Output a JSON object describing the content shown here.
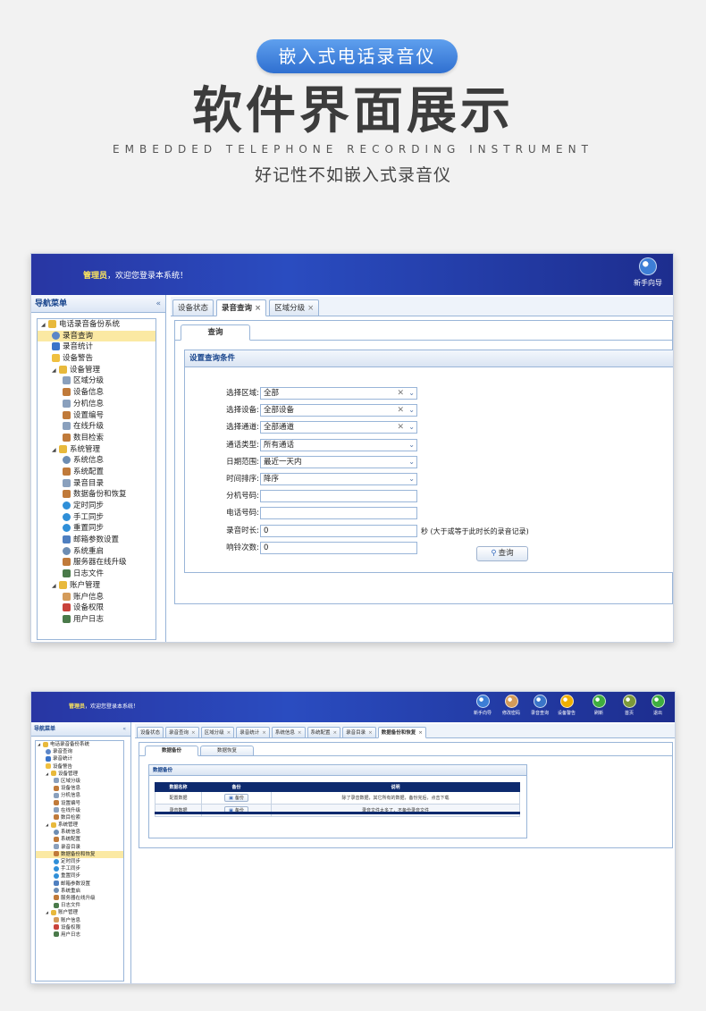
{
  "banner": {
    "pill": "嵌入式电话录音仪",
    "title": "软件界面展示",
    "eng": "EMBEDDED  TELEPHONE  RECORDING  INSTRUMENT",
    "slogan": "好记性不如嵌入式录音仪"
  },
  "colors": {
    "header": "#2836a3",
    "accent": "#2f6fd0",
    "selected": "#fbe9a3",
    "border": "#99b5d8",
    "table_header": "#0d2a6e"
  },
  "shot1": {
    "user": "管理员",
    "welcome": "，欢迎您登录本系统！",
    "toolbar": [
      {
        "label": "新手向导",
        "icon": "guide-icon"
      }
    ],
    "nav_title": "导航菜单",
    "collapse": "«",
    "tree": [
      {
        "label": "电话录音备份系统",
        "icon": "folder-icon",
        "level": 0
      },
      {
        "label": "录音查询",
        "icon": "search-icon",
        "level": 1,
        "selected": true
      },
      {
        "label": "录音统计",
        "icon": "chart-icon",
        "level": 1
      },
      {
        "label": "设备警告",
        "icon": "bulb-icon",
        "level": 1
      },
      {
        "label": "设备管理",
        "icon": "folder-icon",
        "level": 1
      },
      {
        "label": "区域分级",
        "icon": "edit-icon",
        "level": 2
      },
      {
        "label": "设备信息",
        "icon": "tools-icon",
        "level": 2
      },
      {
        "label": "分机信息",
        "icon": "edit-icon",
        "level": 2
      },
      {
        "label": "设置编号",
        "icon": "tools-icon",
        "level": 2
      },
      {
        "label": "在线升级",
        "icon": "edit-icon",
        "level": 2
      },
      {
        "label": "数目检索",
        "icon": "tools-icon",
        "level": 2
      },
      {
        "label": "系统管理",
        "icon": "folder-icon",
        "level": 1
      },
      {
        "label": "系统信息",
        "icon": "gear-icon",
        "level": 2
      },
      {
        "label": "系统配置",
        "icon": "tools-icon",
        "level": 2
      },
      {
        "label": "录音目录",
        "icon": "edit-icon",
        "level": 2
      },
      {
        "label": "数据备份和恢复",
        "icon": "tools-icon",
        "level": 2
      },
      {
        "label": "定时同步",
        "icon": "clock-icon",
        "level": 2
      },
      {
        "label": "手工同步",
        "icon": "clock-icon",
        "level": 2
      },
      {
        "label": "重置同步",
        "icon": "clock-icon",
        "level": 2
      },
      {
        "label": "邮箱参数设置",
        "icon": "mail-icon",
        "level": 2
      },
      {
        "label": "系统重启",
        "icon": "gear-icon",
        "level": 2
      },
      {
        "label": "服务器在线升级",
        "icon": "tools-icon",
        "level": 2
      },
      {
        "label": "日志文件",
        "icon": "log-icon",
        "level": 2
      },
      {
        "label": "账户管理",
        "icon": "folder-icon",
        "level": 1
      },
      {
        "label": "账户信息",
        "icon": "user-icon",
        "level": 2
      },
      {
        "label": "设备权限",
        "icon": "shield-icon",
        "level": 2
      },
      {
        "label": "用户日志",
        "icon": "log-icon",
        "level": 2
      }
    ],
    "tabs": [
      {
        "label": "设备状态",
        "closable": false
      },
      {
        "label": "录音查询",
        "closable": true,
        "active": true
      },
      {
        "label": "区域分级",
        "closable": true
      }
    ],
    "subtab": "查询",
    "panel_title": "设置查询条件",
    "form": [
      {
        "label": "选择区域:",
        "value": "全部",
        "clear": true,
        "dropdown": true
      },
      {
        "label": "选择设备:",
        "value": "全部设备",
        "clear": true,
        "dropdown": true
      },
      {
        "label": "选择通道:",
        "value": "全部通道",
        "clear": true,
        "dropdown": true
      },
      {
        "label": "通话类型:",
        "value": "所有通话",
        "clear": false,
        "dropdown": true
      },
      {
        "label": "日期范围:",
        "value": "最近一天内",
        "clear": false,
        "dropdown": true
      },
      {
        "label": "时间排序:",
        "value": "降序",
        "clear": false,
        "dropdown": true
      },
      {
        "label": "分机号码:",
        "value": "",
        "clear": false,
        "dropdown": false
      },
      {
        "label": "电话号码:",
        "value": "",
        "clear": false,
        "dropdown": false
      },
      {
        "label": "录音时长:",
        "value": "0",
        "clear": false,
        "dropdown": false,
        "hint": "秒 (大于或等于此时长的录音记录)"
      },
      {
        "label": "响铃次数:",
        "value": "0",
        "clear": false,
        "dropdown": false
      }
    ],
    "query_button": "查询"
  },
  "shot2": {
    "user": "管理员",
    "welcome": "，欢迎您登录本系统！",
    "toolbar": [
      {
        "label": "新手向导",
        "icon": "guide-icon"
      },
      {
        "label": "修改密码",
        "icon": "user-icon"
      },
      {
        "label": "录音查询",
        "icon": "chart-icon"
      },
      {
        "label": "设备警告",
        "icon": "warning-icon"
      },
      {
        "label": "刷新",
        "icon": "refresh-icon"
      },
      {
        "label": "首页",
        "icon": "home-icon"
      },
      {
        "label": "退出",
        "icon": "logout-icon"
      }
    ],
    "nav_title": "导航菜单",
    "collapse": "«",
    "tree": [
      {
        "label": "电话录音备份系统",
        "icon": "folder-icon",
        "level": 0
      },
      {
        "label": "录音查询",
        "icon": "search-icon",
        "level": 1
      },
      {
        "label": "录音统计",
        "icon": "chart-icon",
        "level": 1
      },
      {
        "label": "设备警告",
        "icon": "bulb-icon",
        "level": 1
      },
      {
        "label": "设备管理",
        "icon": "folder-icon",
        "level": 1
      },
      {
        "label": "区域分级",
        "icon": "edit-icon",
        "level": 2
      },
      {
        "label": "设备信息",
        "icon": "tools-icon",
        "level": 2
      },
      {
        "label": "分机信息",
        "icon": "edit-icon",
        "level": 2
      },
      {
        "label": "设置编号",
        "icon": "tools-icon",
        "level": 2
      },
      {
        "label": "在线升级",
        "icon": "edit-icon",
        "level": 2
      },
      {
        "label": "数目检索",
        "icon": "tools-icon",
        "level": 2
      },
      {
        "label": "系统管理",
        "icon": "folder-icon",
        "level": 1
      },
      {
        "label": "系统信息",
        "icon": "gear-icon",
        "level": 2
      },
      {
        "label": "系统配置",
        "icon": "tools-icon",
        "level": 2
      },
      {
        "label": "录音目录",
        "icon": "edit-icon",
        "level": 2
      },
      {
        "label": "数据备份和恢复",
        "icon": "tools-icon",
        "level": 2,
        "selected": true
      },
      {
        "label": "定时同步",
        "icon": "clock-icon",
        "level": 2
      },
      {
        "label": "手工同步",
        "icon": "clock-icon",
        "level": 2
      },
      {
        "label": "重置同步",
        "icon": "clock-icon",
        "level": 2
      },
      {
        "label": "邮箱参数设置",
        "icon": "mail-icon",
        "level": 2
      },
      {
        "label": "系统重启",
        "icon": "gear-icon",
        "level": 2
      },
      {
        "label": "服务器在线升级",
        "icon": "tools-icon",
        "level": 2
      },
      {
        "label": "日志文件",
        "icon": "log-icon",
        "level": 2
      },
      {
        "label": "账户管理",
        "icon": "folder-icon",
        "level": 1
      },
      {
        "label": "账户信息",
        "icon": "user-icon",
        "level": 2
      },
      {
        "label": "设备权限",
        "icon": "shield-icon",
        "level": 2
      },
      {
        "label": "用户日志",
        "icon": "log-icon",
        "level": 2
      }
    ],
    "tabs": [
      {
        "label": "设备状态",
        "closable": false
      },
      {
        "label": "录音查询",
        "closable": true
      },
      {
        "label": "区域分级",
        "closable": true
      },
      {
        "label": "录音统计",
        "closable": true
      },
      {
        "label": "系统信息",
        "closable": true
      },
      {
        "label": "系统配置",
        "closable": true
      },
      {
        "label": "录音目录",
        "closable": true
      },
      {
        "label": "数据备份和恢复",
        "closable": true,
        "active": true
      }
    ],
    "subtabs": [
      {
        "label": "数据备份",
        "active": true
      },
      {
        "label": "数据恢复",
        "active": false
      }
    ],
    "panel_title": "数据备份",
    "table": {
      "columns": [
        "数据名称",
        "备份",
        "说明"
      ],
      "rows": [
        {
          "name": "配置数据",
          "button": "备份",
          "desc": "除了录音数据，其它所有的数据，备份完后，点击下载"
        },
        {
          "name": "录音数据",
          "button": "备份",
          "desc": "录音文件太多了，不备份录音文件"
        }
      ]
    }
  }
}
